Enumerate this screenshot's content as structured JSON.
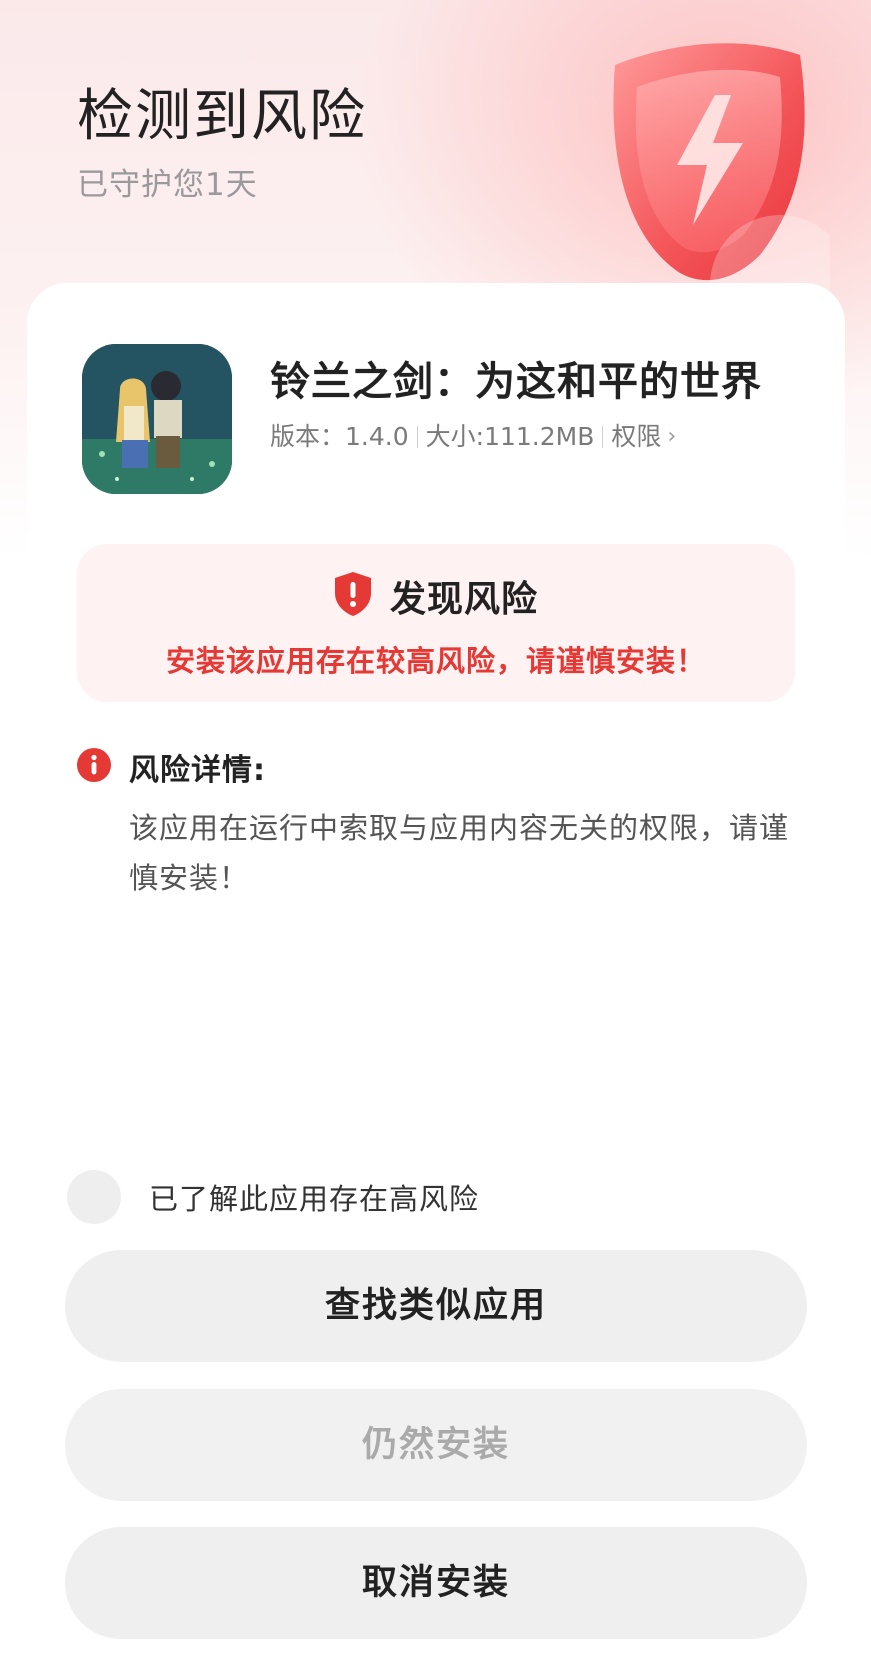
{
  "header": {
    "title": "检测到风险",
    "subtitle": "已守护您1天"
  },
  "app": {
    "name": "铃兰之剑：为这和平的世界",
    "version_label": "版本：",
    "version": "1.4.0",
    "size_label": "大小:",
    "size": "111.2MB",
    "permissions_label": "权限"
  },
  "risk_banner": {
    "title": "发现风险",
    "message": "安装该应用存在较高风险，请谨慎安装！"
  },
  "risk_details": {
    "title": "风险详情:",
    "text": "该应用在运行中索取与应用内容无关的权限，请谨慎安装！"
  },
  "acknowledge": {
    "label": "已了解此应用存在高风险",
    "checked": false
  },
  "buttons": {
    "find_similar": "查找类似应用",
    "install_anyway": "仍然安装",
    "cancel_install": "取消安装"
  },
  "colors": {
    "accent_red": "#e53935",
    "risk_bg": "#fff2f2",
    "button_bg": "#efefef",
    "disabled_text": "#aaaaaa"
  }
}
